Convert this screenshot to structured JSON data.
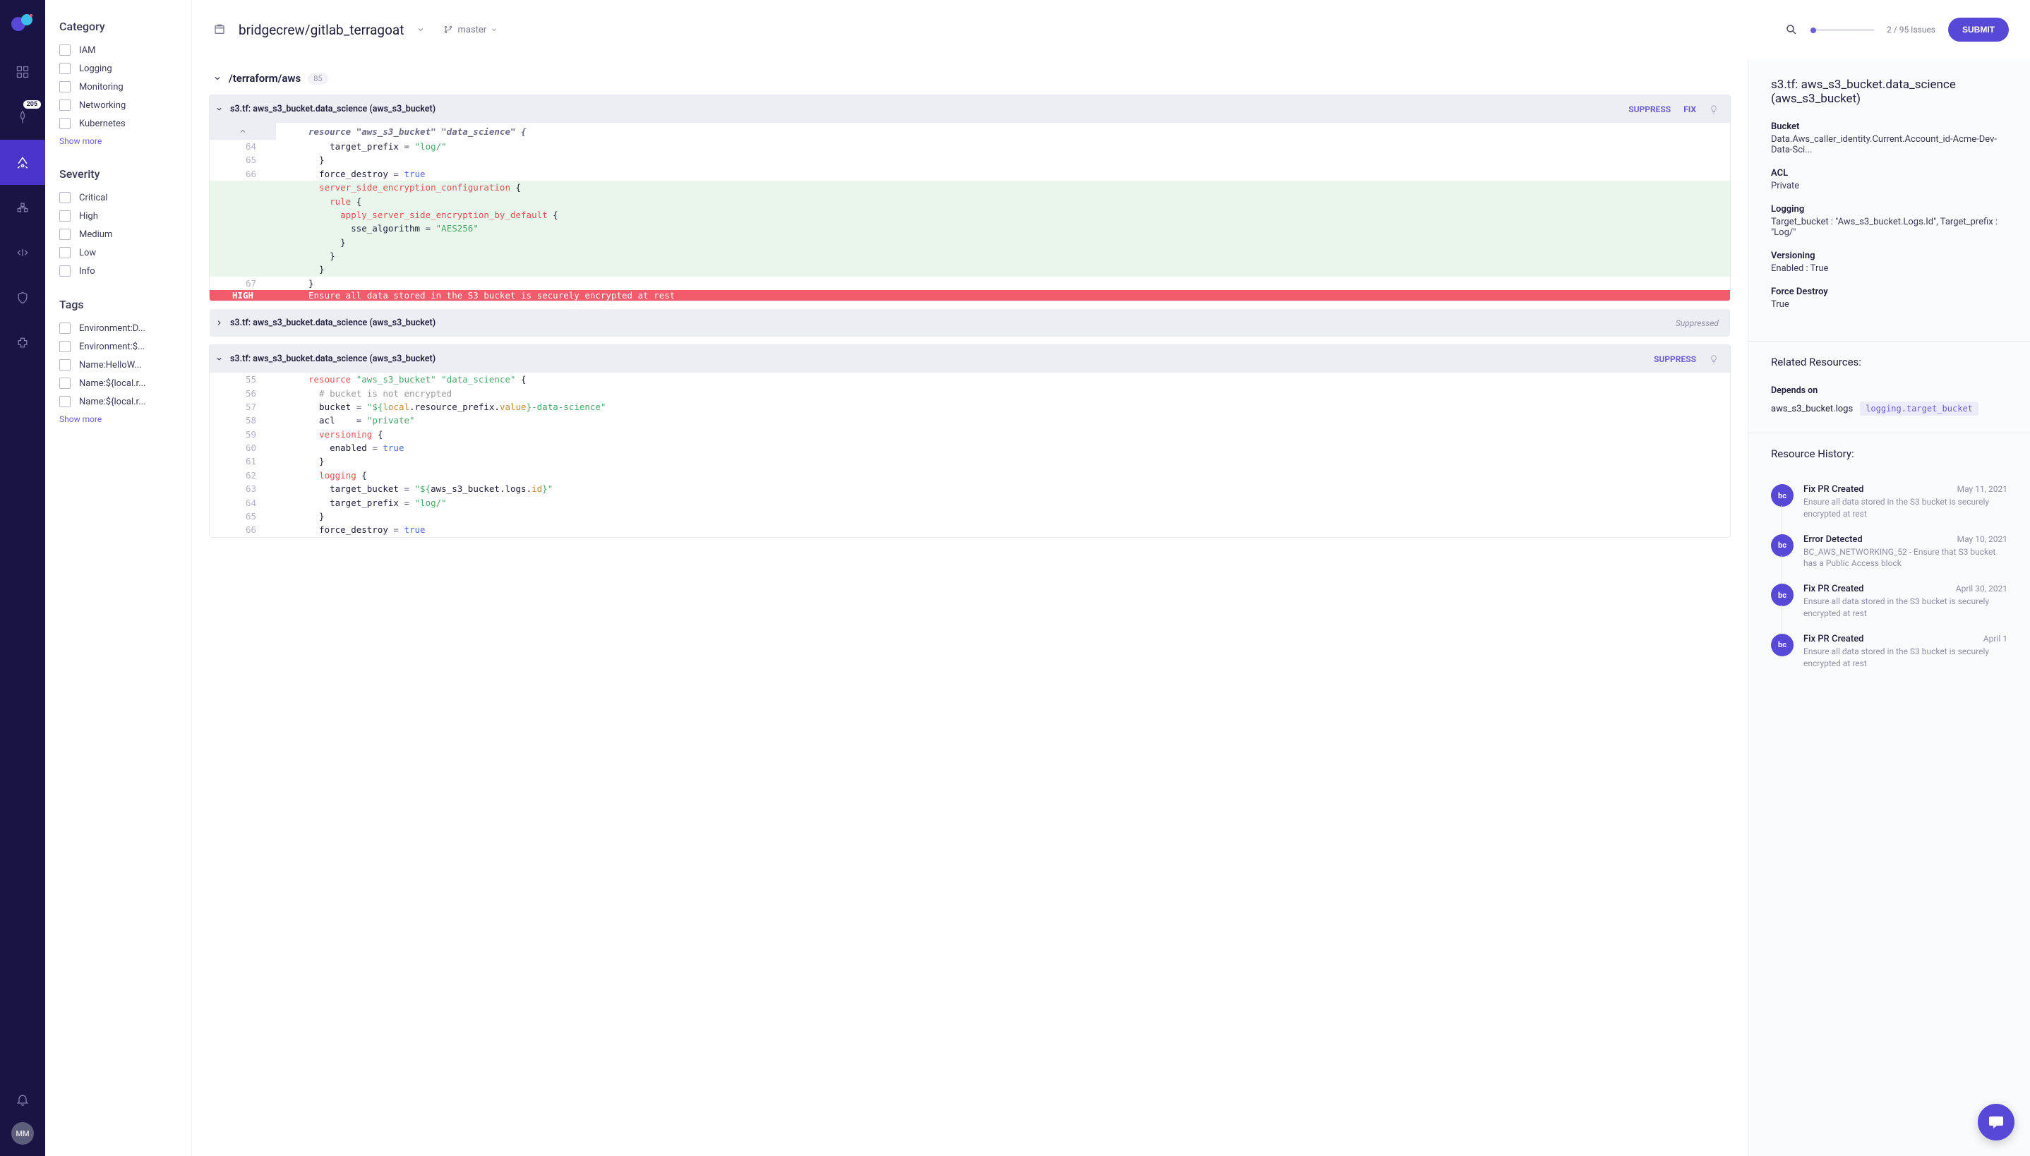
{
  "rail": {
    "badge_count": "205",
    "avatar": "MM"
  },
  "filters": {
    "category": {
      "title": "Category",
      "items": [
        "IAM",
        "Logging",
        "Monitoring",
        "Networking",
        "Kubernetes"
      ],
      "show_more": "Show more"
    },
    "severity": {
      "title": "Severity",
      "items": [
        "Critical",
        "High",
        "Medium",
        "Low",
        "Info"
      ]
    },
    "tags": {
      "title": "Tags",
      "items": [
        "Environment:D...",
        "Environment:$...",
        "Name:HelloW...",
        "Name:${local.r...",
        "Name:${local.r..."
      ],
      "show_more": "Show more"
    }
  },
  "topbar": {
    "repo": "bridgecrew/gitlab_terragoat",
    "branch": "master",
    "issues_count": "2 / 95 Issues",
    "submit": "SUBMIT"
  },
  "folder": {
    "path": "/terraform/aws",
    "count": "85"
  },
  "issues": [
    {
      "title": "s3.tf: aws_s3_bucket.data_science (aws_s3_bucket)",
      "suppress": "SUPPRESS",
      "fix": "FIX",
      "signature": "resource \"aws_s3_bucket\" \"data_science\" {",
      "severity": "HIGH",
      "message": "Ensure all data stored in the S3 bucket is securely encrypted at rest"
    },
    {
      "title": "s3.tf: aws_s3_bucket.data_science (aws_s3_bucket)",
      "suppressed_label": "Suppressed"
    },
    {
      "title": "s3.tf: aws_s3_bucket.data_science (aws_s3_bucket)",
      "suppress": "SUPPRESS"
    }
  ],
  "details": {
    "title": "s3.tf: aws_s3_bucket.data_science (aws_s3_bucket)",
    "meta": [
      {
        "label": "Bucket",
        "value": "Data.Aws_caller_identity.Current.Account_id-Acme-Dev-Data-Sci..."
      },
      {
        "label": "ACL",
        "value": "Private"
      },
      {
        "label": "Logging",
        "value": "Target_bucket : \"Aws_s3_bucket.Logs.Id\", Target_prefix : \"Log/\""
      },
      {
        "label": "Versioning",
        "value": "Enabled : True"
      },
      {
        "label": "Force Destroy",
        "value": "True"
      }
    ],
    "related_header": "Related Resources:",
    "depends_label": "Depends on",
    "depends_name": "aws_s3_bucket.logs",
    "depends_chip": "logging.target_bucket",
    "history_header": "Resource History:",
    "history": [
      {
        "title": "Fix PR Created",
        "date": "May 11, 2021",
        "desc": "Ensure all data stored in the S3 bucket is securely encrypted at rest"
      },
      {
        "title": "Error Detected",
        "date": "May 10, 2021",
        "desc": "BC_AWS_NETWORKING_52 - Ensure that S3 bucket has a Public Access block"
      },
      {
        "title": "Fix PR Created",
        "date": "April 30, 2021",
        "desc": "Ensure all data stored in the S3 bucket is securely encrypted at rest"
      },
      {
        "title": "Fix PR Created",
        "date": "April 1",
        "desc": "Ensure all data stored in the S3 bucket is securely encrypted at rest"
      }
    ]
  },
  "code1": {
    "lines": [
      {
        "n": "64",
        "html": "    target_prefix <span class='tk-op'>=</span> <span class='tk-str'>\"log/\"</span>"
      },
      {
        "n": "65",
        "html": "  }"
      },
      {
        "n": "66",
        "html": "  force_destroy <span class='tk-op'>=</span> <span class='tk-bool'>true</span>"
      },
      {
        "n": "",
        "added": true,
        "html": "  <span class='tk-key'>server_side_encryption_configuration</span> {"
      },
      {
        "n": "",
        "added": true,
        "html": "    <span class='tk-key'>rule</span> {"
      },
      {
        "n": "",
        "added": true,
        "html": "      <span class='tk-key'>apply_server_side_encryption_by_default</span> {"
      },
      {
        "n": "",
        "added": true,
        "html": "        sse_algorithm <span class='tk-op'>=</span> <span class='tk-str'>\"AES256\"</span>"
      },
      {
        "n": "",
        "added": true,
        "html": "      }"
      },
      {
        "n": "",
        "added": true,
        "html": "    }"
      },
      {
        "n": "",
        "added": true,
        "html": "  }"
      },
      {
        "n": "67",
        "html": "}"
      }
    ]
  },
  "code2": {
    "lines": [
      {
        "n": "55",
        "html": "<span class='tk-key'>resource</span> <span class='tk-str'>\"aws_s3_bucket\"</span> <span class='tk-str'>\"data_science\"</span> {"
      },
      {
        "n": "56",
        "html": "  <span class='tk-cmt'># bucket is not encrypted</span>"
      },
      {
        "n": "57",
        "html": "  bucket <span class='tk-op'>=</span> <span class='tk-str'>\"${</span><span class='tk-var'>local</span>.resource_prefix.<span class='tk-var'>value</span><span class='tk-str'>}-data-science\"</span>"
      },
      {
        "n": "58",
        "html": "  acl    <span class='tk-op'>=</span> <span class='tk-str'>\"private\"</span>"
      },
      {
        "n": "59",
        "html": "  <span class='tk-key'>versioning</span> {"
      },
      {
        "n": "60",
        "html": "    enabled <span class='tk-op'>=</span> <span class='tk-bool'>true</span>"
      },
      {
        "n": "61",
        "html": "  }"
      },
      {
        "n": "62",
        "html": "  <span class='tk-key'>logging</span> {"
      },
      {
        "n": "63",
        "html": "    target_bucket <span class='tk-op'>=</span> <span class='tk-str'>\"${</span>aws_s3_bucket.logs.<span class='tk-var'>id</span><span class='tk-str'>}\"</span>"
      },
      {
        "n": "64",
        "html": "    target_prefix <span class='tk-op'>=</span> <span class='tk-str'>\"log/\"</span>"
      },
      {
        "n": "65",
        "html": "  }"
      },
      {
        "n": "66",
        "html": "  force_destroy <span class='tk-op'>=</span> <span class='tk-bool'>true</span>"
      }
    ]
  }
}
